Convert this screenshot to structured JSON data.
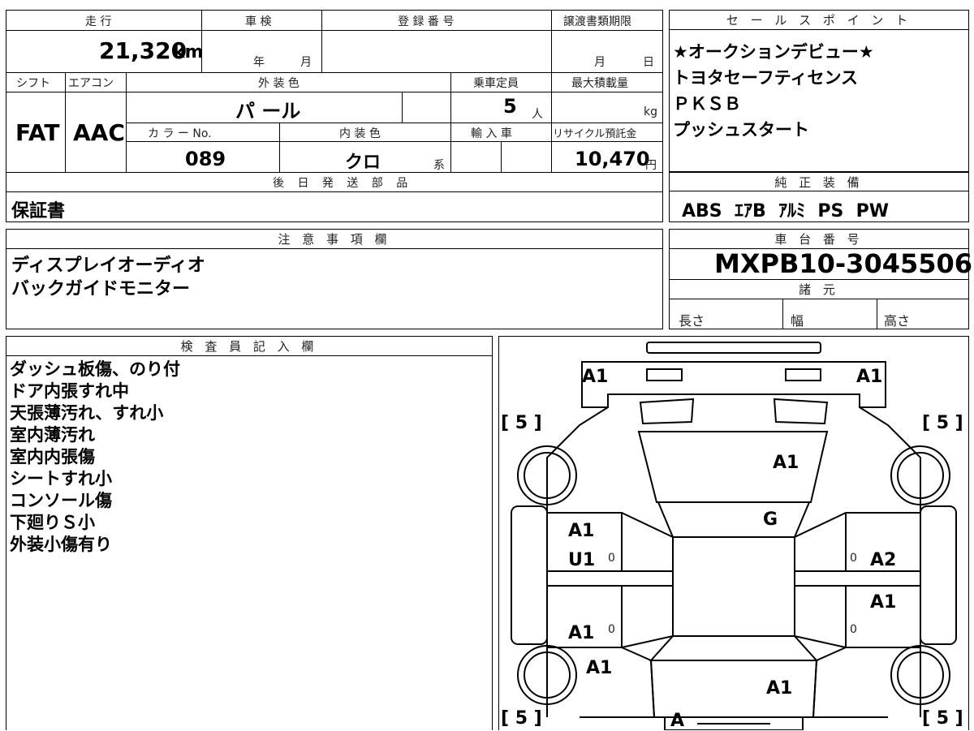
{
  "main_table": {
    "headers": {
      "mileage": "走 行",
      "inspection": "車 検",
      "registration": "登 録 番 号",
      "transfer_deadline": "譲渡書類期限",
      "shift": "シフト",
      "aircon": "エアコン",
      "exterior_color": "外 装 色",
      "capacity": "乗車定員",
      "max_load": "最大積載量",
      "color_no": "カ ラ ー No.",
      "interior_color": "内 装 色",
      "import": "輸 入 車",
      "recycle_fee": "リサイクル預託金",
      "later_parts": "後 日 発 送 部 品"
    },
    "values": {
      "mileage": "21,320",
      "mileage_unit": "km",
      "year_label": "年",
      "month_label": "月",
      "deadline_month": "月",
      "deadline_day": "日",
      "shift": "FAT",
      "aircon": "AAC",
      "exterior_color": "パ ール",
      "capacity": "5",
      "capacity_unit": "人",
      "max_load_unit": "kg",
      "color_no": "089",
      "interior_color": "クロ",
      "interior_suffix": "系",
      "recycle_fee": "10,470",
      "recycle_unit": "円",
      "later_parts": "保証書"
    }
  },
  "sales_points": {
    "header": "セ ー ル ス ポ イ ン ト",
    "items": [
      "★オークションデビュー★",
      "トヨタセーフティセンス",
      "ＰＫＳＢ",
      "プッシュスタート"
    ]
  },
  "equipment": {
    "header": "純 正 装 備",
    "value": "ABS  ｴｱB  ｱﾙﾐ  PS  PW"
  },
  "notes": {
    "header": "注 意 事 項 欄",
    "lines": [
      "ディスプレイオーディオ",
      "バックガイドモニター"
    ]
  },
  "chassis": {
    "header": "車 台 番 号",
    "value": "MXPB10-3045506",
    "spec_header": "諸 元",
    "length": "長さ",
    "width": "幅",
    "height": "高さ"
  },
  "inspector": {
    "header": "検 査 員 記 入 欄",
    "lines": [
      "ダッシュ板傷、のり付",
      "ドア内張すれ中",
      "天張薄汚れ、すれ小",
      "室内薄汚れ",
      "室内内張傷",
      "シートすれ小",
      "コンソール傷",
      "下廻りＳ小",
      "外装小傷有り"
    ]
  },
  "diagram": {
    "labels": {
      "rear_left": "A1",
      "rear_right": "A1",
      "rear_glass": "A1",
      "roof": "G",
      "left_rear_door_1": "A1",
      "left_rear_door_2": "U1",
      "right_rear_door": "A2",
      "right_front_door": "A1",
      "left_front_door": "A1",
      "left_front_fender": "A1",
      "hood": "A1",
      "front_bumper": "A"
    },
    "tire_brackets": [
      "[ 5 ]",
      "[ 5 ]",
      "[ 5 ]",
      "[ 5 ]"
    ],
    "zero_marks": [
      "0",
      "0",
      "0",
      "0"
    ]
  },
  "colors": {
    "line": "#000000",
    "background": "#ffffff"
  }
}
